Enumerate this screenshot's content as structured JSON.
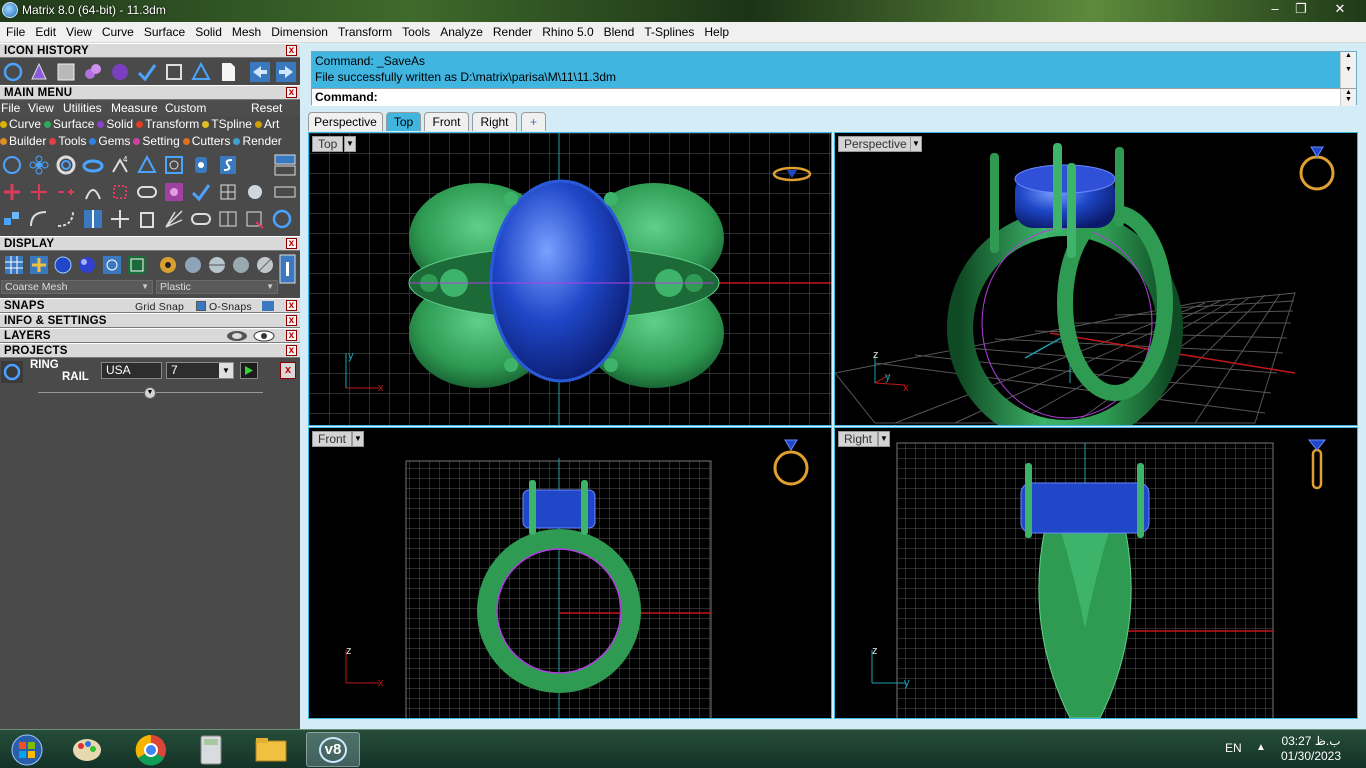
{
  "window": {
    "title": "Matrix 8.0 (64-bit) - 11.3dm",
    "controls": [
      "minimize",
      "maximize",
      "close"
    ]
  },
  "menubar": {
    "items": [
      "File",
      "Edit",
      "View",
      "Curve",
      "Surface",
      "Solid",
      "Mesh",
      "Dimension",
      "Transform",
      "Tools",
      "Analyze",
      "Render",
      "Rhino 5.0",
      "Blend",
      "T-Splines",
      "Help"
    ]
  },
  "left_panel": {
    "icon_history": {
      "title": "ICON HISTORY"
    },
    "main_menu": {
      "title": "MAIN MENU",
      "menu": [
        "File",
        "View",
        "Utilities",
        "Measure",
        "Custom"
      ],
      "reset": "Reset",
      "categories_row1": [
        {
          "label": "Curve",
          "color": "#e0b000"
        },
        {
          "label": "Surface",
          "color": "#2eaa5a"
        },
        {
          "label": "Solid",
          "color": "#8a3fd0"
        },
        {
          "label": "Transform",
          "color": "#e04020"
        },
        {
          "label": "TSpline",
          "color": "#e0c020"
        },
        {
          "label": "Art",
          "color": "#d0a000"
        }
      ],
      "categories_row2": [
        {
          "label": "Builder",
          "color": "#e09020"
        },
        {
          "label": "Tools",
          "color": "#e04040"
        },
        {
          "label": "Gems",
          "color": "#3080e0"
        },
        {
          "label": "Setting",
          "color": "#d040a0"
        },
        {
          "label": "Cutters",
          "color": "#e07020"
        },
        {
          "label": "Render",
          "color": "#40a0d0"
        }
      ]
    },
    "display": {
      "title": "DISPLAY",
      "mesh_option": "Coarse Mesh",
      "material_option": "Plastic"
    },
    "snaps": {
      "title": "SNAPS",
      "grid_snap": "Grid Snap",
      "o_snaps": "O-Snaps"
    },
    "info": {
      "title": "INFO & SETTINGS"
    },
    "layers": {
      "title": "LAYERS"
    },
    "projects": {
      "title": "PROJECTS",
      "ring_label": "RING",
      "rail_label": "RAIL",
      "size_standard": "USA",
      "size_value": "7"
    }
  },
  "command": {
    "history_line1": "Command: _SaveAs",
    "history_line2": "File successfully written as D:\\matrix\\parisa\\M\\11\\11.3dm",
    "prompt_label": "Command:"
  },
  "viewport_tabs": [
    "Perspective",
    "Top",
    "Front",
    "Right",
    "+"
  ],
  "active_tab": "Top",
  "viewports": {
    "top": {
      "label": "Top",
      "axis_v": "y",
      "axis_h": "x"
    },
    "perspective": {
      "label": "Perspective",
      "axis_v": "z",
      "axis_h": "x",
      "axis_d": "y"
    },
    "front": {
      "label": "Front",
      "axis_v": "z",
      "axis_h": "x"
    },
    "right": {
      "label": "Right",
      "axis_v": "z",
      "axis_h": "y"
    }
  },
  "colors": {
    "accent": "#3fb5e0",
    "metal": "#2e9a52",
    "stone": "#1f47c8",
    "axis_red": "#c01818",
    "axis_cyan": "#20a0b0",
    "rail": "#b040e0"
  },
  "taskbar": {
    "apps": [
      "start-orb",
      "paint",
      "chrome",
      "calculator",
      "file-explorer",
      "matrix-v8"
    ],
    "active_app_label": "v8",
    "language": "EN",
    "time": "03:27 ب.ظ",
    "date": "01/30/2023"
  }
}
